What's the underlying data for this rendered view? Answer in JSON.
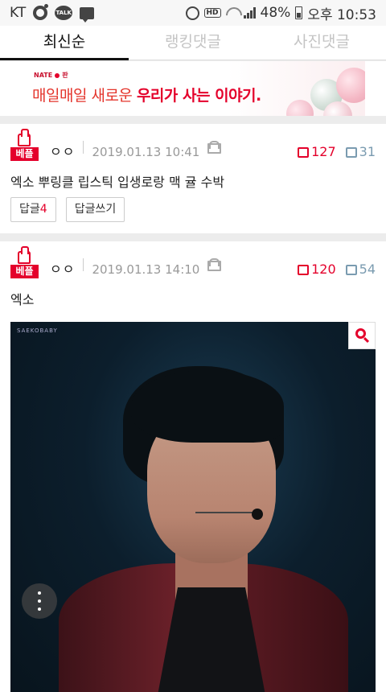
{
  "status_bar": {
    "carrier": "KT",
    "battery": "48%",
    "time": "오후 10:53",
    "hd_label": "HD",
    "icons": [
      "o-app-icon",
      "kakaotalk-icon",
      "message-icon",
      "alarm-icon",
      "hd-icon",
      "wifi-icon",
      "signal-icon",
      "battery-icon"
    ]
  },
  "tabs": [
    {
      "label": "최신순",
      "active": true
    },
    {
      "label": "랭킹댓글",
      "active": false
    },
    {
      "label": "사진댓글",
      "active": false
    }
  ],
  "banner": {
    "logo": "NATE",
    "logo_sub": "판",
    "text_plain": "매일매일 새로운 ",
    "text_bold": "우리가 사는 이야기."
  },
  "posts": [
    {
      "badge": "베플",
      "nickname": "ㅇㅇ",
      "date": "2019.01.13 10:41",
      "upvotes": "127",
      "downvotes": "31",
      "text": "엑소 뿌링클 립스틱 입생로랑 맥 귤 수박",
      "reply_label": "답글",
      "reply_count": "4",
      "write_reply_label": "답글쓰기"
    },
    {
      "badge": "베플",
      "nickname": "ㅇㅇ",
      "date": "2019.01.13 14:10",
      "upvotes": "120",
      "downvotes": "54",
      "text": "엑소",
      "photo_watermark": "SAEKOBABY"
    }
  ],
  "colors": {
    "accent": "#e4002b",
    "downvote": "#7a9bb0",
    "muted": "#999999"
  }
}
